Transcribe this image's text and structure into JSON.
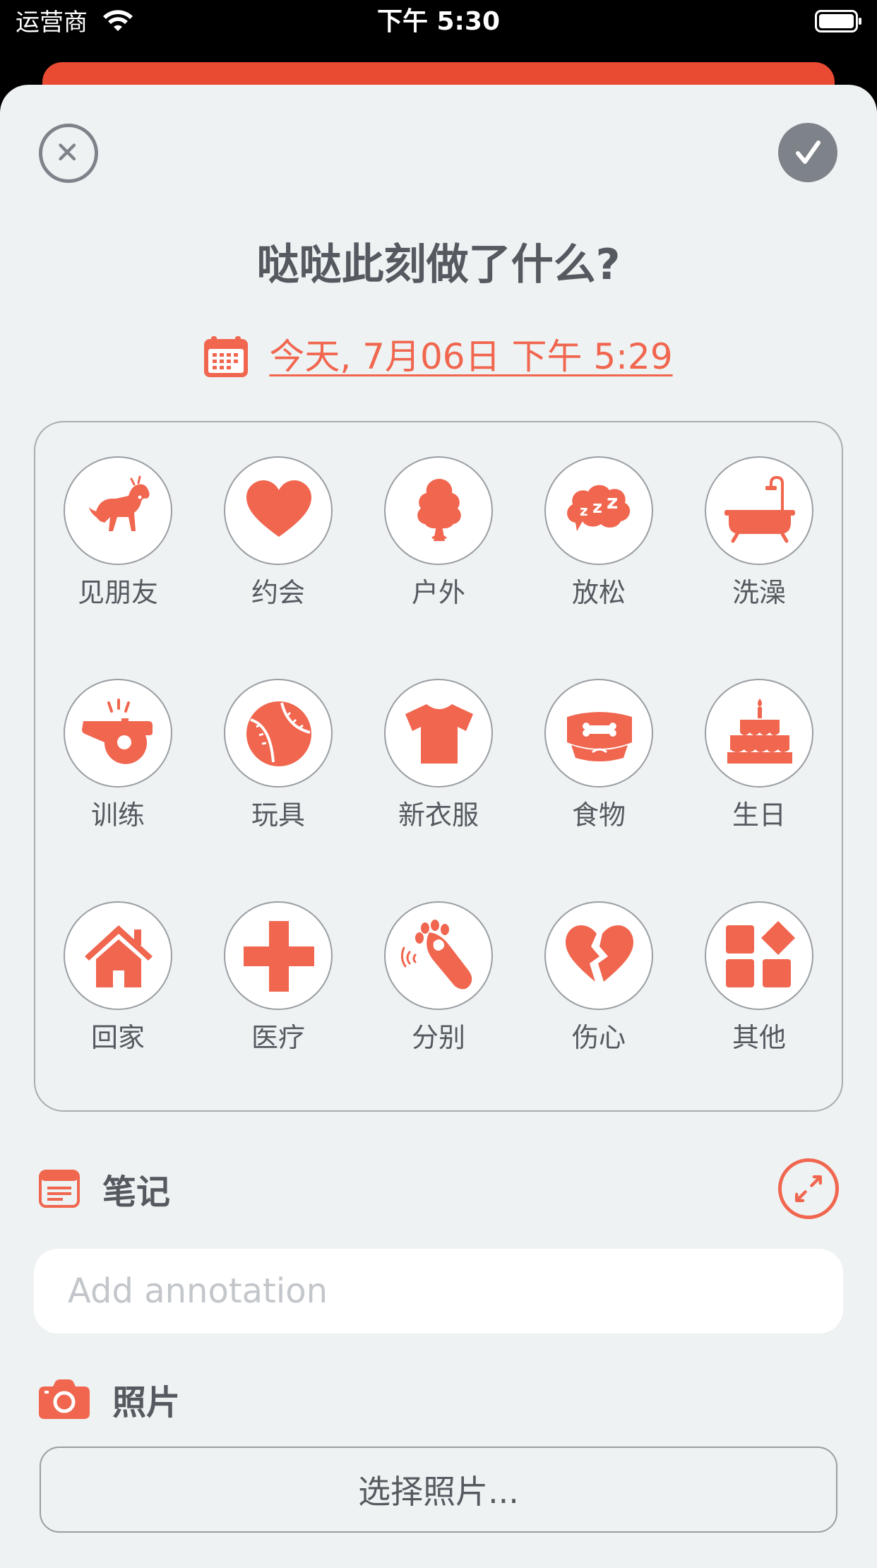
{
  "status_bar": {
    "carrier": "运营商",
    "time": "下午 5:30"
  },
  "header": {
    "title": "哒哒此刻做了什么?",
    "date": "今天, 7月06日 下午 5:29"
  },
  "activities": [
    {
      "label": "见朋友",
      "icon": "dog-icon"
    },
    {
      "label": "约会",
      "icon": "heart-icon"
    },
    {
      "label": "户外",
      "icon": "tree-icon"
    },
    {
      "label": "放松",
      "icon": "sleep-icon"
    },
    {
      "label": "洗澡",
      "icon": "bathtub-icon"
    },
    {
      "label": "训练",
      "icon": "whistle-icon"
    },
    {
      "label": "玩具",
      "icon": "ball-icon"
    },
    {
      "label": "新衣服",
      "icon": "tshirt-icon"
    },
    {
      "label": "食物",
      "icon": "food-bowl-icon"
    },
    {
      "label": "生日",
      "icon": "cake-icon"
    },
    {
      "label": "回家",
      "icon": "house-icon"
    },
    {
      "label": "医疗",
      "icon": "medical-cross-icon"
    },
    {
      "label": "分别",
      "icon": "waving-paw-icon"
    },
    {
      "label": "伤心",
      "icon": "broken-heart-icon"
    },
    {
      "label": "其他",
      "icon": "grid-icon"
    }
  ],
  "notes": {
    "label": "笔记",
    "placeholder": "Add annotation"
  },
  "photos": {
    "label": "照片",
    "button": "选择照片..."
  },
  "colors": {
    "accent": "#f0664f",
    "banner": "#e84a32",
    "sheet_bg": "#eff2f3",
    "text": "#555a60",
    "gray_button": "#7e838a"
  }
}
